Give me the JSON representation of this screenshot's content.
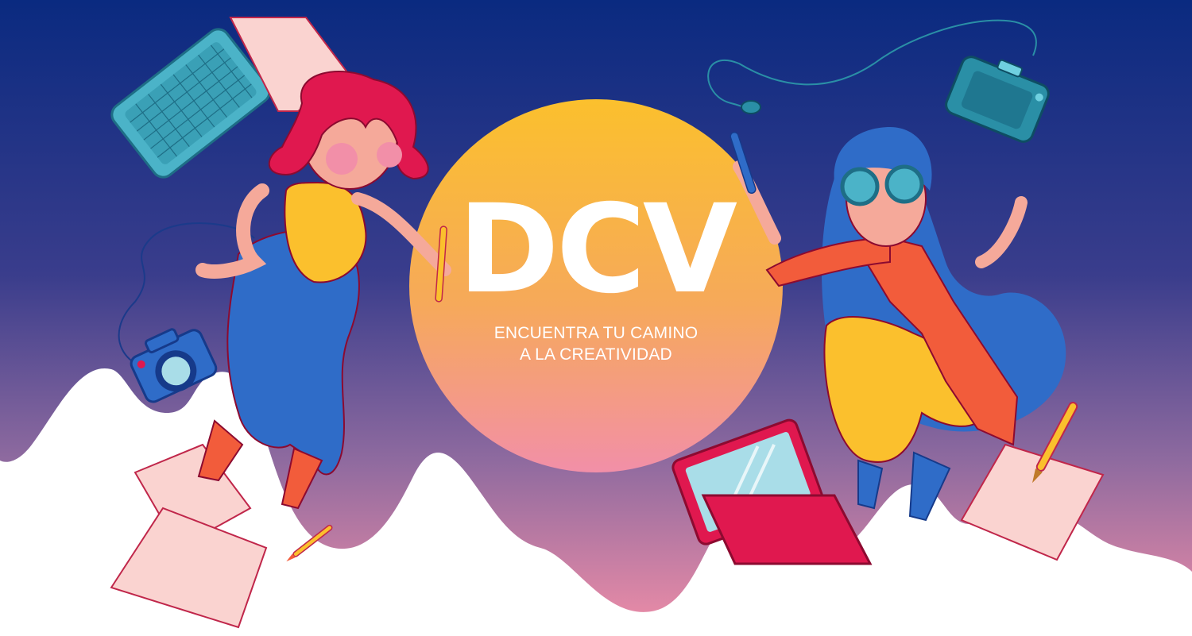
{
  "brand": {
    "logo": "DCV",
    "tagline_line1": "ENCUENTRA TU CAMINO",
    "tagline_line2": "A LA CREATIVIDAD"
  },
  "colors": {
    "sky_top": "#0a2a80",
    "sky_mid": "#3a3d8c",
    "sky_bottom": "#e389a6",
    "sun_top": "#fbc02d",
    "sun_bottom": "#f28fa8",
    "accent_red": "#e0184f",
    "accent_orange": "#f25c3b",
    "accent_blue": "#2f6cc8",
    "accent_yellow": "#fbc02d",
    "accent_teal": "#2a8fa6"
  },
  "illustrations": [
    "woman-left-red-hair",
    "woman-right-blue-hair",
    "keyboard-icon",
    "camera-icon",
    "laptop-icon",
    "drawing-tablet-icon",
    "pen-icon",
    "brush-icon",
    "paper-sheet"
  ]
}
